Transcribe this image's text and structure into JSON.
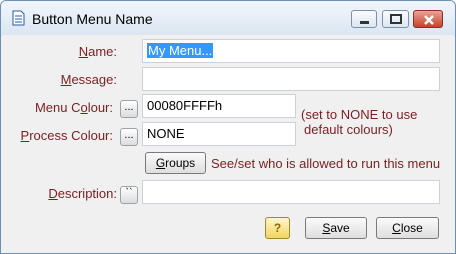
{
  "window": {
    "title": "Button Menu Name"
  },
  "form": {
    "name": {
      "label_accel": "N",
      "label_rest": "ame:",
      "value": "My Menu..."
    },
    "message": {
      "label_accel": "M",
      "label_rest": "essage:",
      "value": ""
    },
    "menu_colour": {
      "label_pre": "Menu C",
      "label_accel": "o",
      "label_rest": "lour:",
      "value": "00080FFFFh",
      "button": "..."
    },
    "process_colour": {
      "label_accel": "P",
      "label_rest": "rocess Colour:",
      "value": "NONE",
      "button": "..."
    },
    "colour_note_1": "(set to NONE to use",
    "colour_note_2": "default colours)",
    "groups": {
      "label_accel": "G",
      "label_rest": "roups",
      "note": "See/set who is allowed to run this menu"
    },
    "description": {
      "label_accel": "D",
      "label_rest": "escription:",
      "value": "",
      "button": "``"
    }
  },
  "footer": {
    "help_glyph": "?",
    "save": {
      "accel": "S",
      "rest": "ave"
    },
    "close": {
      "accel": "C",
      "rest": "lose"
    }
  }
}
